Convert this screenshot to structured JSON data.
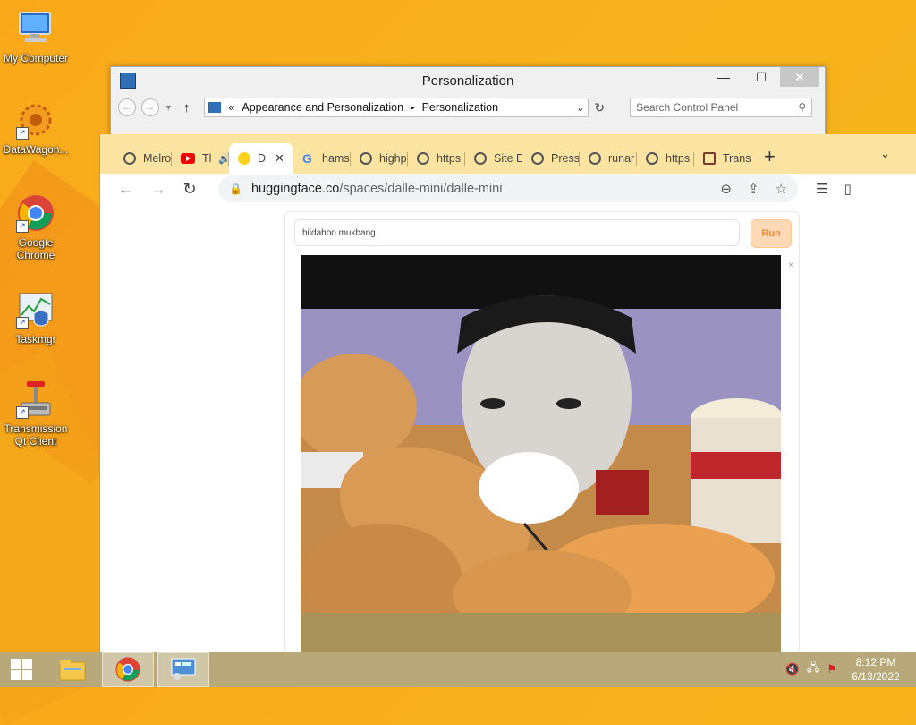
{
  "desktop": {
    "icons": [
      {
        "label": "My Computer"
      },
      {
        "label": "DataWagon..."
      },
      {
        "label": "Google Chrome"
      },
      {
        "label": "Taskmgr"
      },
      {
        "label": "Transmission Qt Client"
      }
    ]
  },
  "control_panel": {
    "title": "Personalization",
    "breadcrumb": [
      "«",
      "Appearance and Personalization",
      "▸",
      "Personalization"
    ],
    "search_placeholder": "Search Control Panel",
    "controls": {
      "minimize": "—",
      "maximize": "☐",
      "close": "✕"
    }
  },
  "chrome": {
    "tabs": [
      {
        "label": "Melro",
        "icon": "globe-icon"
      },
      {
        "label": "Tl",
        "icon": "youtube-icon",
        "audio": true
      },
      {
        "label": "D",
        "icon": "huggingface-icon",
        "active": true
      },
      {
        "label": "hams",
        "icon": "google-icon"
      },
      {
        "label": "highp",
        "icon": "globe-icon"
      },
      {
        "label": "https",
        "icon": "globe-icon"
      },
      {
        "label": "Site E",
        "icon": "globe-icon"
      },
      {
        "label": "Press",
        "icon": "globe-icon"
      },
      {
        "label": "runar",
        "icon": "globe-icon"
      },
      {
        "label": "https",
        "icon": "globe-icon"
      },
      {
        "label": "Trans",
        "icon": "translate-icon"
      }
    ],
    "new_tab": "+",
    "url_host": "huggingface.co",
    "url_path": "/spaces/dalle-mini/dalle-mini"
  },
  "app": {
    "prompt": "hildaboo mukbang",
    "run_label": "Run",
    "close_image": "×"
  },
  "taskbar": {
    "time": "8:12 PM",
    "date": "6/13/2022"
  }
}
